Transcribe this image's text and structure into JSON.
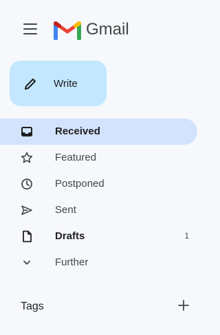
{
  "app": {
    "brand": "Gmail"
  },
  "compose": {
    "label": "Write"
  },
  "nav": {
    "items": [
      {
        "label": "Received",
        "icon": "inbox-icon"
      },
      {
        "label": "Featured",
        "icon": "star-icon"
      },
      {
        "label": "Postponed",
        "icon": "clock-icon"
      },
      {
        "label": "Sent",
        "icon": "send-icon"
      },
      {
        "label": "Drafts",
        "icon": "file-icon",
        "count": "1"
      },
      {
        "label": "Further",
        "icon": "chevron-down-icon"
      }
    ]
  },
  "tags": {
    "label": "Tags",
    "add_icon": "plus-icon"
  },
  "colors": {
    "background": "#f6f8fc",
    "compose": "#c2e7ff",
    "active_item": "#d3e3fd",
    "logo_red": "#ea4335",
    "logo_blue": "#4285f4",
    "logo_green": "#34a853",
    "logo_yellow": "#fbbc04"
  }
}
